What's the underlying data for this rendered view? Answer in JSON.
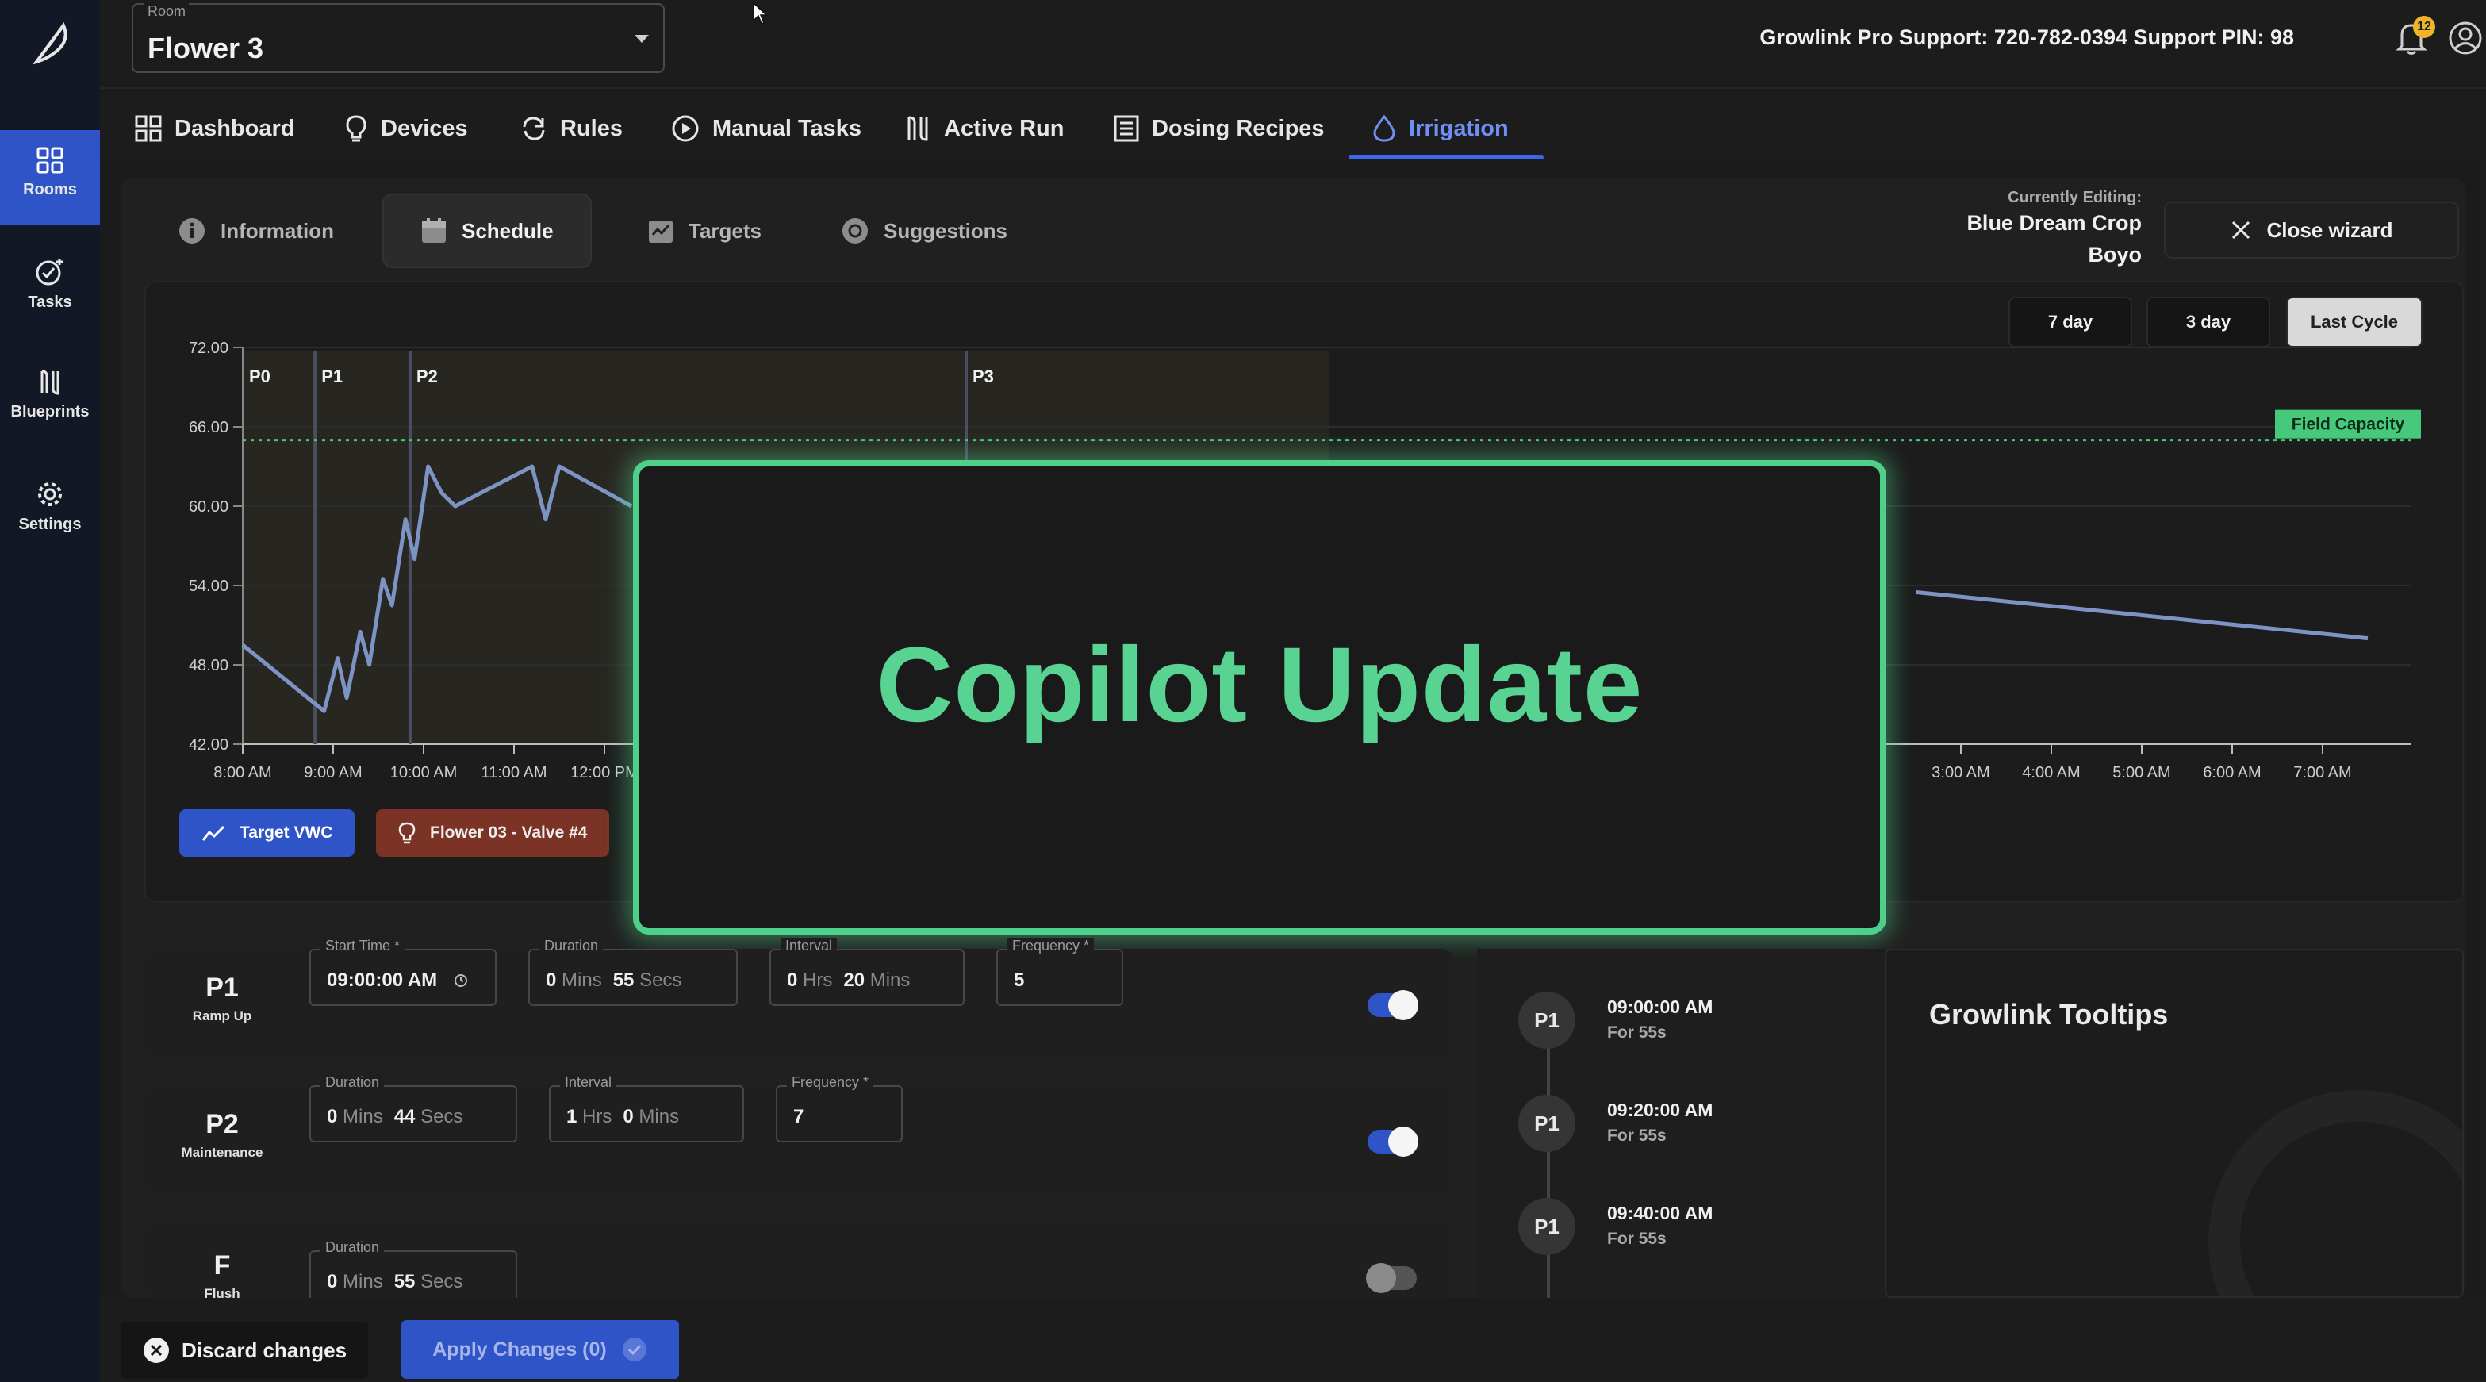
{
  "rail": {
    "items": [
      {
        "label": "Rooms",
        "icon": "grid-icon"
      },
      {
        "label": "Tasks",
        "icon": "tasks-icon"
      },
      {
        "label": "Blueprints",
        "icon": "blueprints-icon"
      },
      {
        "label": "Settings",
        "icon": "gear-icon"
      }
    ]
  },
  "topbar": {
    "room_label": "Room",
    "room_value": "Flower 3",
    "support": "Growlink Pro Support: 720-782-0394  Support PIN: 98",
    "notifications": "12"
  },
  "nav": {
    "items": [
      {
        "label": "Dashboard",
        "icon": "dashboard-icon"
      },
      {
        "label": "Devices",
        "icon": "bulb-icon"
      },
      {
        "label": "Rules",
        "icon": "refresh-icon"
      },
      {
        "label": "Manual Tasks",
        "icon": "play-circle-icon"
      },
      {
        "label": "Active Run",
        "icon": "active-run-icon"
      },
      {
        "label": "Dosing Recipes",
        "icon": "list-icon"
      },
      {
        "label": "Irrigation",
        "icon": "drop-icon"
      }
    ],
    "active": "Irrigation"
  },
  "wizard": {
    "tabs": [
      {
        "label": "Information",
        "icon": "info-icon"
      },
      {
        "label": "Schedule",
        "icon": "calendar-icon"
      },
      {
        "label": "Targets",
        "icon": "chart-check-icon"
      },
      {
        "label": "Suggestions",
        "icon": "compass-icon"
      }
    ],
    "active_tab": "Schedule",
    "editing_label": "Currently Editing:",
    "editing_line1": "Blue Dream Crop",
    "editing_line2": "Boyo",
    "close_label": "Close wizard"
  },
  "chart_data": {
    "type": "line",
    "ylim": [
      42,
      72
    ],
    "y_ticks": [
      "72.00",
      "66.00",
      "60.00",
      "54.00",
      "48.00",
      "42.00"
    ],
    "x_ticks_left": [
      "8:00 AM",
      "9:00 AM",
      "10:00 AM",
      "11:00 AM",
      "12:00 PM"
    ],
    "x_ticks_right": [
      "3:00 AM",
      "4:00 AM",
      "5:00 AM",
      "6:00 AM",
      "7:00 AM"
    ],
    "phase_markers": [
      "P0",
      "P1",
      "P2",
      "P3"
    ],
    "field_capacity": 65,
    "field_capacity_label": "Field Capacity",
    "series": [
      {
        "name": "Target VWC",
        "values": [
          [
            8.0,
            49.5
          ],
          [
            8.9,
            44.5
          ],
          [
            9.05,
            48.5
          ],
          [
            9.15,
            45.5
          ],
          [
            9.3,
            50.5
          ],
          [
            9.4,
            48
          ],
          [
            9.55,
            54.5
          ],
          [
            9.65,
            52.5
          ],
          [
            9.8,
            59
          ],
          [
            9.9,
            56
          ],
          [
            10.05,
            63
          ],
          [
            10.2,
            61
          ],
          [
            10.35,
            60
          ],
          [
            11.2,
            63
          ],
          [
            11.35,
            59
          ],
          [
            11.5,
            63
          ],
          [
            12.3,
            60
          ]
        ]
      },
      {
        "values": [
          [
            26.5,
            53.5
          ],
          [
            31.5,
            50
          ]
        ]
      }
    ],
    "range_buttons": [
      "7 day",
      "3 day",
      "Last Cycle"
    ],
    "active_range": "Last Cycle",
    "legend": [
      {
        "label": "Target VWC",
        "color": "#2f54c8",
        "icon": "trend-icon"
      },
      {
        "label": "Flower 03 - Valve #4",
        "color": "#7a3325",
        "icon": "bulb-icon"
      }
    ]
  },
  "overlay": {
    "title": "Copilot Update",
    "color": "#58d392"
  },
  "phases": [
    {
      "code": "P1",
      "name": "Ramp Up",
      "start_label": "Start Time *",
      "start_value": "09:00:00 AM",
      "duration_label": "Duration",
      "duration_mins": "0",
      "duration_secs": "55",
      "interval_label": "Interval",
      "interval_hrs": "0",
      "interval_mins": "20",
      "frequency_label": "Frequency *",
      "frequency": "5",
      "enabled": true
    },
    {
      "code": "P2",
      "name": "Maintenance",
      "duration_label": "Duration",
      "duration_mins": "0",
      "duration_secs": "44",
      "interval_label": "Interval",
      "interval_hrs": "1",
      "interval_mins": "0",
      "frequency_label": "Frequency *",
      "frequency": "7",
      "enabled": true
    },
    {
      "code": "F",
      "name": "Flush",
      "duration_label": "Duration",
      "duration_mins": "0",
      "duration_secs": "55",
      "enabled": false
    }
  ],
  "units": {
    "mins": "Mins",
    "secs": "Secs",
    "hrs": "Hrs"
  },
  "timeline": [
    {
      "phase": "P1",
      "time": "09:00:00 AM",
      "duration": "For 55s"
    },
    {
      "phase": "P1",
      "time": "09:20:00 AM",
      "duration": "For 55s"
    },
    {
      "phase": "P1",
      "time": "09:40:00 AM",
      "duration": "For 55s"
    }
  ],
  "tooltips": {
    "title": "Growlink Tooltips"
  },
  "footer": {
    "discard_label": "Discard changes",
    "apply_label": "Apply Changes (0)"
  },
  "colors": {
    "accent": "#2f54c8",
    "line": "#7d93c4",
    "field_capacity": "#46c97a"
  }
}
